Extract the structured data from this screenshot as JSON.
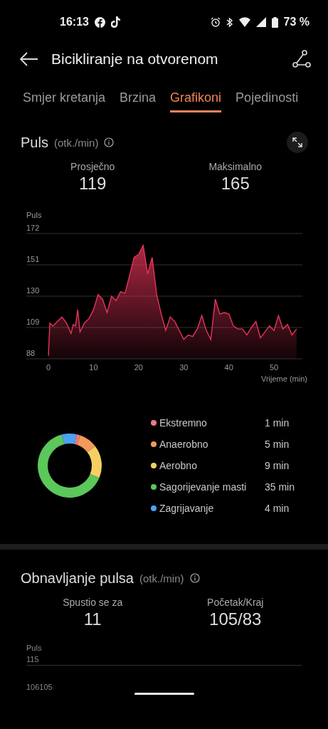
{
  "status_bar": {
    "time": "16:13",
    "battery": "73 %"
  },
  "header": {
    "title": "Bicikliranje na otvorenom"
  },
  "tabs": [
    {
      "label": "Smjer kretanja",
      "selected": false
    },
    {
      "label": "Brzina",
      "selected": false
    },
    {
      "label": "Grafikoni",
      "selected": true
    },
    {
      "label": "Pojedinosti",
      "selected": false
    }
  ],
  "heart_rate": {
    "title": "Puls",
    "unit": "(otk./min)",
    "stats": [
      {
        "label": "Prosječno",
        "value": "119"
      },
      {
        "label": "Maksimalno",
        "value": "165"
      }
    ],
    "chart_data": {
      "type": "area",
      "grid": true,
      "xlabel": "Vrijeme (min)",
      "xlim": [
        -4.9,
        56.3
      ],
      "ylim": [
        88,
        172
      ],
      "yticks": [
        88,
        109,
        130,
        151,
        172
      ],
      "xticks": [
        0,
        10,
        20,
        30,
        40,
        50
      ],
      "x": [
        0,
        0.3,
        1,
        2,
        3,
        4,
        5,
        5.5,
        6,
        6.5,
        7,
        8,
        9,
        10,
        11,
        12,
        13,
        14,
        15,
        16,
        17,
        18,
        19,
        20,
        21,
        22,
        23,
        24,
        25,
        26,
        27,
        28,
        29,
        30,
        31,
        32,
        33,
        34,
        35,
        36,
        37,
        38,
        39,
        40,
        41,
        42,
        43,
        44,
        45,
        46,
        47,
        48,
        49,
        50,
        51,
        52,
        53,
        54,
        55
      ],
      "series": [
        {
          "name": "Puls",
          "color": "#e8345a",
          "values": [
            90,
            112,
            110,
            113,
            116,
            112,
            105,
            111,
            110,
            121,
            106,
            112,
            115,
            121,
            131,
            128,
            119,
            130,
            127,
            133,
            132,
            144,
            156,
            158,
            164,
            145,
            156,
            131,
            118,
            107,
            116,
            113,
            107,
            101,
            104,
            103,
            108,
            117,
            107,
            101,
            128,
            118,
            119,
            118,
            110,
            108,
            108,
            104,
            109,
            113,
            102,
            106,
            110,
            107,
            117,
            108,
            111,
            104,
            108
          ]
        }
      ]
    }
  },
  "zones": {
    "items": [
      {
        "label": "Ekstremno",
        "duration": "1 min",
        "color": "#f07a80"
      },
      {
        "label": "Anaerobno",
        "duration": "5 min",
        "color": "#f29a5c"
      },
      {
        "label": "Aerobno",
        "duration": "9 min",
        "color": "#f5cf62"
      },
      {
        "label": "Sagorijevanje masti",
        "duration": "35 min",
        "color": "#5cc75a"
      },
      {
        "label": "Zagrijavanje",
        "duration": "4 min",
        "color": "#4ea2f2"
      }
    ],
    "chart_data": {
      "type": "donut",
      "values": [
        1.85,
        9.26,
        16.67,
        64.81,
        7.41
      ]
    }
  },
  "recovery": {
    "title": "Obnavljanje pulsa",
    "unit": "(otk./min)",
    "stats": [
      {
        "label": "Spustio se za",
        "value": "11"
      },
      {
        "label": "Početak/Kraj",
        "value": "105/83"
      }
    ],
    "ylabel": "Puls",
    "ticks": [
      "115",
      "106",
      "105"
    ]
  }
}
